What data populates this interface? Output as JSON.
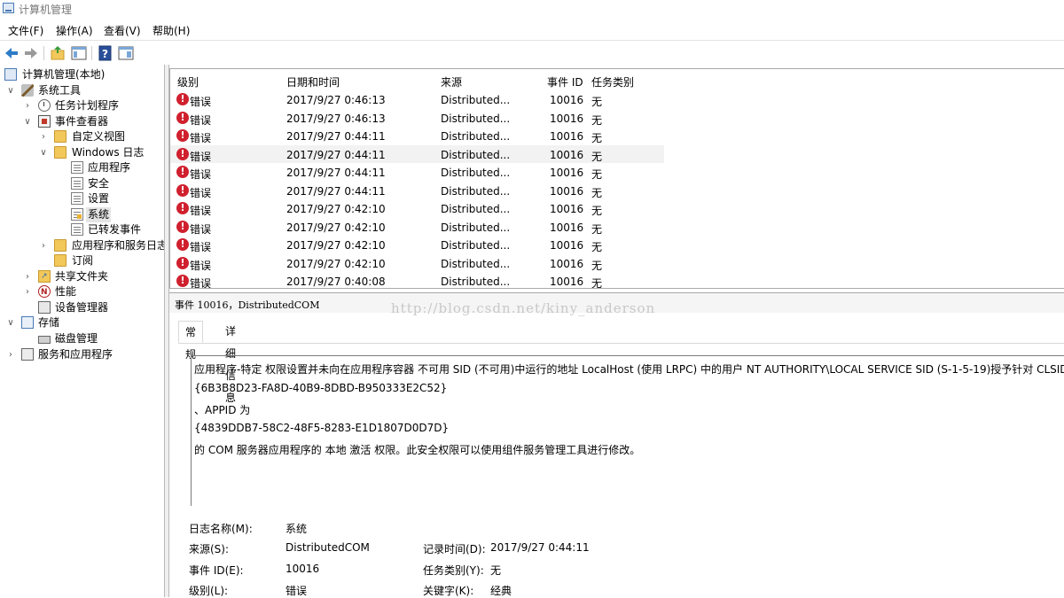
{
  "window": {
    "title": "计算机管理"
  },
  "menu": [
    "文件(F)",
    "操作(A)",
    "查看(V)",
    "帮助(H)"
  ],
  "toolbar": {
    "back": "back-arrow-icon",
    "forward": "forward-arrow-icon",
    "up": "up-folder-icon",
    "show_hide_tree": "console-tree-icon",
    "help": "help-icon",
    "properties": "properties-icon"
  },
  "tree": [
    {
      "label": "计算机管理(本地)",
      "icon": "computer-icon",
      "twisty": "",
      "name": "tree-computer-management"
    },
    {
      "label": "系统工具",
      "icon": "tools-icon",
      "twisty": "∨",
      "name": "tree-system-tools"
    },
    {
      "label": "任务计划程序",
      "icon": "clock-icon",
      "twisty": "›",
      "name": "tree-task-scheduler"
    },
    {
      "label": "事件查看器",
      "icon": "event-viewer-icon",
      "twisty": "∨",
      "name": "tree-event-viewer"
    },
    {
      "label": "自定义视图",
      "icon": "folder-icon",
      "twisty": "›",
      "name": "tree-custom-views"
    },
    {
      "label": "Windows 日志",
      "icon": "folder-icon",
      "twisty": "∨",
      "name": "tree-windows-logs"
    },
    {
      "label": "应用程序",
      "icon": "log-icon",
      "twisty": "",
      "name": "tree-log-application"
    },
    {
      "label": "安全",
      "icon": "log-icon",
      "twisty": "",
      "name": "tree-log-security"
    },
    {
      "label": "设置",
      "icon": "log-icon",
      "twisty": "",
      "name": "tree-log-setup"
    },
    {
      "label": "系统",
      "icon": "log-icon",
      "twisty": "",
      "name": "tree-log-system"
    },
    {
      "label": "已转发事件",
      "icon": "log-icon",
      "twisty": "",
      "name": "tree-log-forwarded"
    },
    {
      "label": "应用程序和服务日志",
      "icon": "folder-icon",
      "twisty": "›",
      "name": "tree-app-service-logs"
    },
    {
      "label": "订阅",
      "icon": "folder-icon",
      "twisty": "",
      "name": "tree-subscriptions"
    },
    {
      "label": "共享文件夹",
      "icon": "shared-folder-icon",
      "twisty": "›",
      "name": "tree-shared-folders"
    },
    {
      "label": "性能",
      "icon": "performance-icon",
      "twisty": "›",
      "name": "tree-performance"
    },
    {
      "label": "设备管理器",
      "icon": "device-manager-icon",
      "twisty": "",
      "name": "tree-device-manager"
    },
    {
      "label": "存储",
      "icon": "storage-icon",
      "twisty": "∨",
      "name": "tree-storage"
    },
    {
      "label": "磁盘管理",
      "icon": "disk-icon",
      "twisty": "",
      "name": "tree-disk-management"
    },
    {
      "label": "服务和应用程序",
      "icon": "services-icon",
      "twisty": "›",
      "name": "tree-services-apps"
    }
  ],
  "events": {
    "columns": [
      "级别",
      "日期和时间",
      "来源",
      "事件 ID",
      "任务类别"
    ],
    "rows": [
      [
        "错误",
        "2017/9/27 0:46:13",
        "Distributed...",
        "10016",
        "无"
      ],
      [
        "错误",
        "2017/9/27 0:46:13",
        "Distributed...",
        "10016",
        "无"
      ],
      [
        "错误",
        "2017/9/27 0:44:11",
        "Distributed...",
        "10016",
        "无"
      ],
      [
        "错误",
        "2017/9/27 0:44:11",
        "Distributed...",
        "10016",
        "无"
      ],
      [
        "错误",
        "2017/9/27 0:44:11",
        "Distributed...",
        "10016",
        "无"
      ],
      [
        "错误",
        "2017/9/27 0:44:11",
        "Distributed...",
        "10016",
        "无"
      ],
      [
        "错误",
        "2017/9/27 0:42:10",
        "Distributed...",
        "10016",
        "无"
      ],
      [
        "错误",
        "2017/9/27 0:42:10",
        "Distributed...",
        "10016",
        "无"
      ],
      [
        "错误",
        "2017/9/27 0:42:10",
        "Distributed...",
        "10016",
        "无"
      ],
      [
        "错误",
        "2017/9/27 0:42:10",
        "Distributed...",
        "10016",
        "无"
      ],
      [
        "错误",
        "2017/9/27 0:40:08",
        "Distributed...",
        "10016",
        "无"
      ]
    ]
  },
  "detail": {
    "header": "事件 10016，DistributedCOM",
    "watermark": "http://blog.csdn.net/kiny_anderson",
    "tabs": [
      "常规",
      "详细信息"
    ],
    "description": [
      "应用程序-特定 权限设置并未向在应用程序容器 不可用 SID (不可用)中运行的地址 LocalHost (使用 LRPC) 中的用户 NT AUTHORITY\\LOCAL SERVICE SID (S-1-5-19)授予针对 CLSID 为",
      "{6B3B8D23-FA8D-40B9-8DBD-B950333E2C52}",
      "、APPID 为",
      "{4839DDB7-58C2-48F5-8283-E1D1807D0D7D}",
      " 的 COM 服务器应用程序的 本地 激活 权限。此安全权限可以使用组件服务管理工具进行修改。"
    ],
    "props": {
      "log_name_label": "日志名称(M):",
      "log_name": "系统",
      "source_label": "来源(S):",
      "source": "DistributedCOM",
      "logged_label": "记录时间(D):",
      "logged": "2017/9/27 0:44:11",
      "event_id_label": "事件 ID(E):",
      "event_id": "10016",
      "task_label": "任务类别(Y):",
      "task": "无",
      "level_label": "级别(L):",
      "level": "错误",
      "keywords_label": "关键字(K):",
      "keywords": "经典"
    }
  },
  "colors": {
    "error": "#d0202e",
    "selected_row": "#f2f2f2",
    "watermark": "#c8c8c8"
  }
}
